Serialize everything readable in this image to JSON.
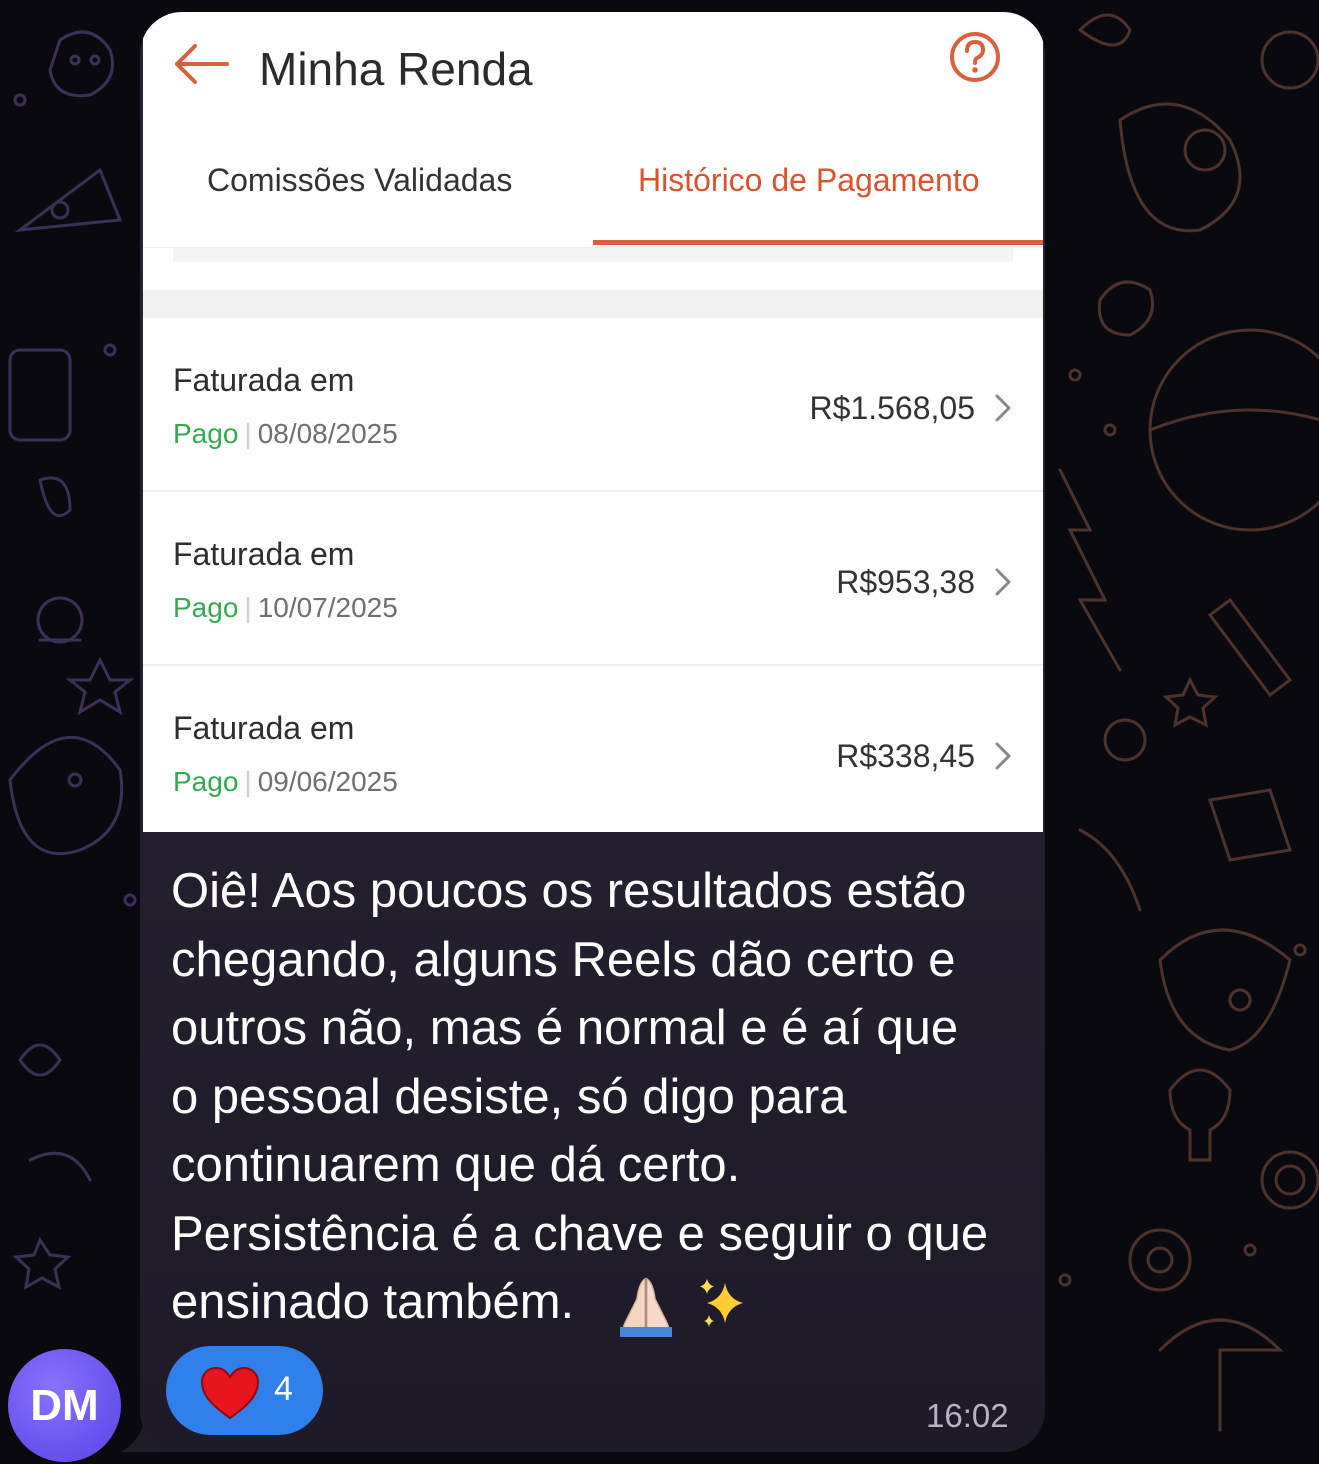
{
  "app": {
    "title": "Minha Renda",
    "tabs": [
      {
        "label": "Comissões Validadas",
        "active": false
      },
      {
        "label": "Histórico de Pagamento",
        "active": true
      }
    ]
  },
  "payments": [
    {
      "label": "Faturada em",
      "status": "Pago",
      "date": "08/08/2025",
      "amount": "R$1.568,05"
    },
    {
      "label": "Faturada em",
      "status": "Pago",
      "date": "10/07/2025",
      "amount": "R$953,38"
    },
    {
      "label": "Faturada em",
      "status": "Pago",
      "date": "09/06/2025",
      "amount": "R$338,45"
    }
  ],
  "message": {
    "lines": [
      "Oiê! Aos poucos os resultados estão",
      "chegando, alguns Reels dão certo e",
      "outros não, mas é normal e é aí que",
      "o pessoal desiste, só digo para",
      "continuarem que dá certo.",
      "Persistência é a chave e seguir o que",
      "ensinado também."
    ],
    "time": "16:02",
    "reaction_count": "4"
  },
  "sender": {
    "initials": "DM"
  },
  "colors": {
    "accent": "#d9603d",
    "paid": "#35a852",
    "reaction": "#2f80ea",
    "bubble": "#25202f",
    "avatar": "#6a55f0"
  },
  "icons": [
    "back-arrow-icon",
    "help-icon",
    "chevron-right-icon",
    "heart-icon",
    "folded-hands-icon",
    "sparkles-icon"
  ]
}
